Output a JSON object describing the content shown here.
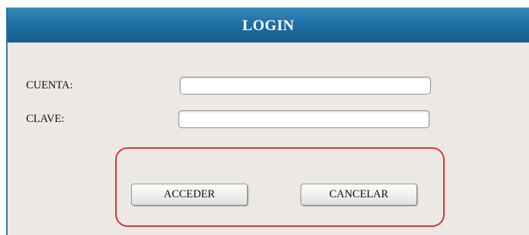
{
  "header": {
    "title": "LOGIN"
  },
  "form": {
    "account_label": "CUENTA:",
    "account_value": "",
    "password_label": "CLAVE:",
    "password_value": ""
  },
  "actions": {
    "access_label": "ACCEDER",
    "cancel_label": "CANCELAR"
  },
  "colors": {
    "header_blue": "#1f6fa5",
    "panel_background": "#ece9e4",
    "highlight_red": "#e21f26"
  }
}
